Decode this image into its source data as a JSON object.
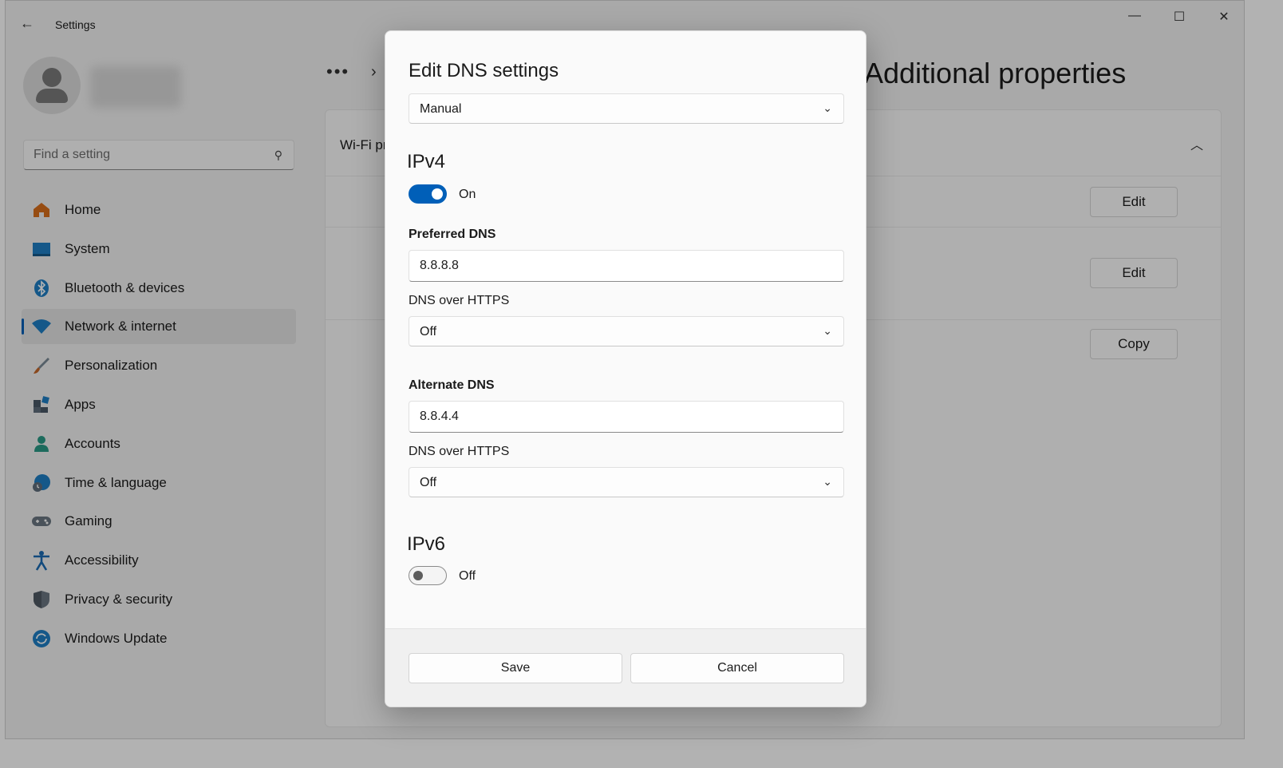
{
  "app": {
    "title": "Settings"
  },
  "window_controls": {
    "minimize": "—",
    "maximize": "☐",
    "close": "✕"
  },
  "search": {
    "placeholder": "Find a setting"
  },
  "sidebar": {
    "items": [
      {
        "label": "Home",
        "icon": "home-icon",
        "color": "#d96f1c"
      },
      {
        "label": "System",
        "icon": "system-icon",
        "color": "#1f7fc4"
      },
      {
        "label": "Bluetooth & devices",
        "icon": "bluetooth-icon",
        "color": "#1f7fc4"
      },
      {
        "label": "Network & internet",
        "icon": "wifi-icon",
        "color": "#1f7fc4",
        "active": true
      },
      {
        "label": "Personalization",
        "icon": "brush-icon",
        "color": "#c4672a"
      },
      {
        "label": "Apps",
        "icon": "apps-icon",
        "color": "#4a5866"
      },
      {
        "label": "Accounts",
        "icon": "accounts-icon",
        "color": "#2a9a86"
      },
      {
        "label": "Time & language",
        "icon": "globe-clock-icon",
        "color": "#1f7fc4"
      },
      {
        "label": "Gaming",
        "icon": "gamepad-icon",
        "color": "#6b7681"
      },
      {
        "label": "Accessibility",
        "icon": "accessibility-icon",
        "color": "#1a6bb3"
      },
      {
        "label": "Privacy & security",
        "icon": "shield-icon",
        "color": "#6b7681"
      },
      {
        "label": "Windows Update",
        "icon": "update-icon",
        "color": "#1f7fc4"
      }
    ]
  },
  "main": {
    "breadcrumb_more": "•••",
    "page_title": "Additional properties",
    "card_heading": "Wi-Fi properties",
    "buttons": [
      "Edit",
      "Edit",
      "Copy"
    ]
  },
  "dialog": {
    "title": "Edit DNS settings",
    "mode": "Manual",
    "ipv4": {
      "heading": "IPv4",
      "toggle_state": "On",
      "preferred_label": "Preferred DNS",
      "preferred_value": "8.8.8.8",
      "preferred_doh_label": "DNS over HTTPS",
      "preferred_doh_value": "Off",
      "alternate_label": "Alternate DNS",
      "alternate_value": "8.8.4.4",
      "alternate_doh_label": "DNS over HTTPS",
      "alternate_doh_value": "Off"
    },
    "ipv6": {
      "heading": "IPv6",
      "toggle_state": "Off"
    },
    "save_label": "Save",
    "cancel_label": "Cancel"
  },
  "colors": {
    "accent": "#005fb8"
  }
}
